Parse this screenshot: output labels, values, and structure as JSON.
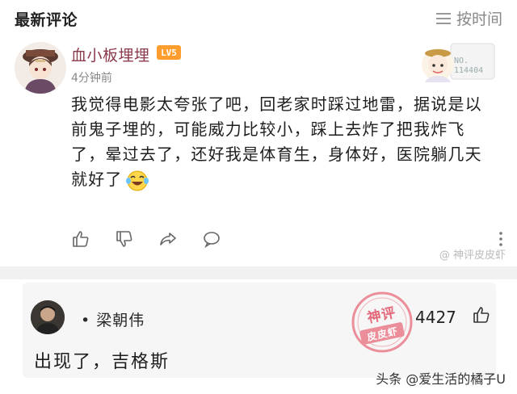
{
  "header": {
    "title": "最新评论",
    "sort_label": "按时间",
    "sort_icon": "list-icon"
  },
  "comment": {
    "username": "血小板埋埋",
    "level": "LV5",
    "timestamp": "4分钟前",
    "fan_card_text": "NO.\n114404",
    "body": "我觉得电影太夸张了吧，回老家时踩过地雷，据说是以前鬼子埋的，可能威力比较小，踩上去炸了把我炸飞了，晕过去了，还好我是体育生，身体好，医院躺几天就好了",
    "actions": [
      "thumbs-up-icon",
      "thumbs-down-icon",
      "share-icon",
      "comment-icon",
      "more-icon"
    ]
  },
  "watermark_top": "@ 神评皮皮虾",
  "reply": {
    "username": "梁朝伟",
    "likes": "4427",
    "text": "出现了，吉格斯",
    "stamp_lines": [
      "神评",
      "皮皮虾"
    ]
  },
  "watermark_bottom": "头条 @爱生活的橘子U",
  "colors": {
    "username_comment": "#8a3a4a",
    "level_badge": "#ff9d2e",
    "stamp": "#e3697a",
    "muted": "#888888"
  }
}
